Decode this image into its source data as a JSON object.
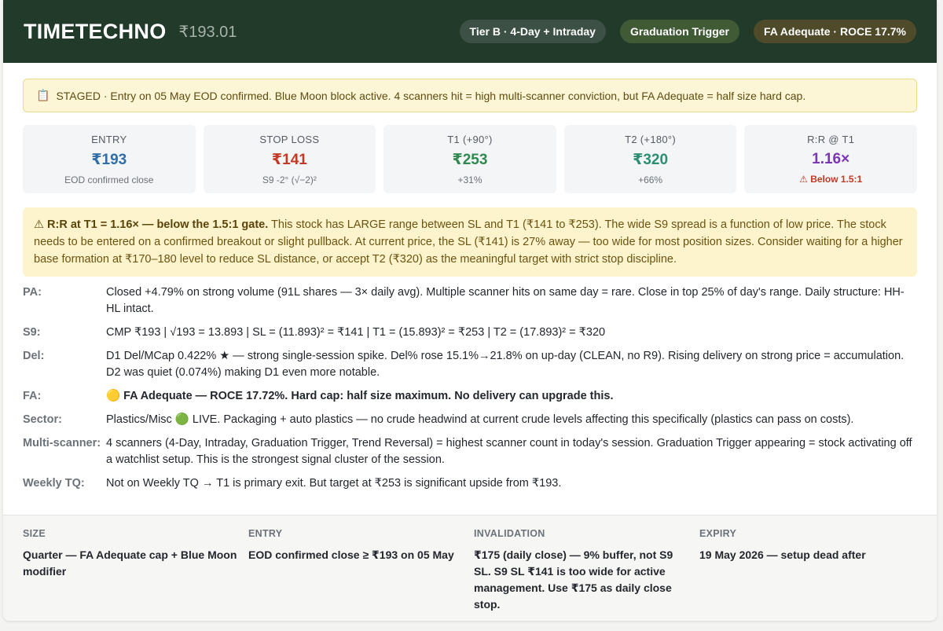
{
  "header": {
    "ticker": "TIMETECHNO",
    "price": "₹193.01",
    "tags": [
      "Tier B · 4-Day + Intraday",
      "Graduation Trigger",
      "FA Adequate · ROCE 17.7%"
    ]
  },
  "staged": {
    "icon": "📋",
    "text": "STAGED · Entry on 05 May EOD confirmed. Blue Moon block active. 4 scanners hit = high multi-scanner conviction, but FA Adequate = half size hard cap."
  },
  "stats": [
    {
      "label": "ENTRY",
      "value": "₹193",
      "sub": "EOD confirmed close"
    },
    {
      "label": "STOP LOSS",
      "value": "₹141",
      "sub": "S9 -2° (√−2)²"
    },
    {
      "label": "T1 (+90°)",
      "value": "₹253",
      "sub": "+31%"
    },
    {
      "label": "T2 (+180°)",
      "value": "₹320",
      "sub": "+66%"
    },
    {
      "label": "R:R @ T1",
      "value": "1.16×",
      "sub": "⚠ Below 1.5:1"
    }
  ],
  "warning": {
    "bold": "⚠ R:R at T1 = 1.16× — below the 1.5:1 gate.",
    "text": " This stock has LARGE range between SL and T1 (₹141 to ₹253). The wide S9 spread is a function of low price. The stock needs to be entered on a confirmed breakout or slight pullback. At current price, the SL (₹141) is 27% away — too wide for most position sizes. Consider waiting for a higher base formation at ₹170–180 level to reduce SL distance, or accept T2 (₹320) as the meaningful target with strict stop discipline."
  },
  "rows": {
    "pa": {
      "key": "PA:",
      "value": "Closed +4.79% on strong volume (91L shares — 3× daily avg). Multiple scanner hits on same day = rare. Close in top 25% of day's range. Daily structure: HH-HL intact."
    },
    "s9": {
      "key": "S9:",
      "value": "CMP ₹193 | √193 = 13.893 | SL = (11.893)² = ₹141 | T1 = (15.893)² = ₹253 | T2 = (17.893)² = ₹320"
    },
    "del": {
      "key": "Del:",
      "value": "D1 Del/MCap 0.422% ★ — strong single-session spike. Del% rose 15.1%→21.8% on up-day (CLEAN, no R9). Rising delivery on strong price = accumulation. D2 was quiet (0.074%) making D1 even more notable."
    },
    "fa": {
      "key": "FA:",
      "value": "🟡 FA Adequate — ROCE 17.72%. Hard cap: half size maximum. No delivery can upgrade this."
    },
    "sector": {
      "key": "Sector:",
      "value": "Plastics/Misc 🟢 LIVE. Packaging + auto plastics — no crude headwind at current crude levels affecting this specifically (plastics can pass on costs)."
    },
    "multi": {
      "key": "Multi-scanner:",
      "value": "4 scanners (4-Day, Intraday, Graduation Trigger, Trend Reversal) = highest scanner count in today's session. Graduation Trigger appearing = stock activating off a watchlist setup. This is the strongest signal cluster of the session."
    },
    "weekly": {
      "key": "Weekly TQ:",
      "value": "Not on Weekly TQ → T1 is primary exit. But target at ₹253 is significant upside from ₹193."
    }
  },
  "footer": [
    {
      "label": "SIZE",
      "value": "Quarter — FA Adequate cap + Blue Moon modifier"
    },
    {
      "label": "ENTRY",
      "value": "EOD confirmed close ≥ ₹193 on 05 May"
    },
    {
      "label": "INVALIDATION",
      "value": "₹175 (daily close) — 9% buffer, not S9 SL. S9 SL ₹141 is too wide for active management. Use ₹175 as daily close stop."
    },
    {
      "label": "EXPIRY",
      "value": "19 May 2026 — setup dead after"
    }
  ],
  "colors": {
    "header_bg": "#213a2a",
    "entry": "#2f6ea8",
    "stop": "#c23a26",
    "t1": "#2e8a4f",
    "t2": "#2a8f73",
    "rr": "#7b35b6",
    "fa_highlight": "#d88a1a"
  }
}
